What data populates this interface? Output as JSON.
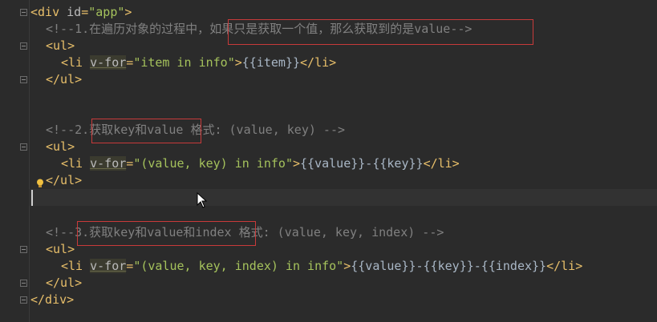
{
  "code": {
    "l1_open": "<div ",
    "l1_attr": "id",
    "l1_eq": "=",
    "l1_val": "\"app\"",
    "l1_close": ">",
    "c1_prefix": "<!--1.在遍历对象的过程中，",
    "c1_box": "如果只是获取一个值，那么获取到的是value-->",
    "ul_open": "<ul>",
    "ul_close": "</ul>",
    "li_open": "<li ",
    "li_close": "</li>",
    "vfor": "v-for",
    "eq": "=",
    "tag_end": ">",
    "v1_expr": "\"item in info\"",
    "v1_body": "{{item}}",
    "c2_prefix": "<!--2.",
    "c2_box": "获取key和value",
    "c2_suffix": " 格式: (value, key) -->",
    "v2_expr": "\"(value, key) in info\"",
    "v2_body": "{{value}}-{{key}}",
    "c3_prefix": "<!--",
    "c3_box": "3.获取key和value和index",
    "c3_suffix": " 格式: (value, key, index) -->",
    "v3_expr": "\"(value, key, index) in info\"",
    "v3_body": "{{value}}-{{key}}-{{index}}",
    "div_close": "</div>"
  },
  "colors": {
    "background": "#2b2b2b",
    "tag": "#e8bf6a",
    "string": "#a5c25c",
    "comment": "#808080",
    "annotation_box": "#c83a3a"
  },
  "icons": [
    "fold-marker-icon",
    "lightbulb-icon",
    "mouse-pointer-icon"
  ]
}
